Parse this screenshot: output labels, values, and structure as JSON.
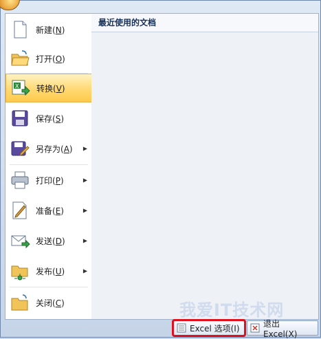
{
  "menu": {
    "items": [
      {
        "label": "新建",
        "key": "N",
        "has_submenu": false
      },
      {
        "label": "打开",
        "key": "O",
        "has_submenu": false
      },
      {
        "label": "转换",
        "key": "V",
        "has_submenu": false,
        "active": true
      },
      {
        "label": "保存",
        "key": "S",
        "has_submenu": false
      },
      {
        "label": "另存为",
        "key": "A",
        "has_submenu": true
      },
      {
        "label": "打印",
        "key": "P",
        "has_submenu": true
      },
      {
        "label": "准备",
        "key": "E",
        "has_submenu": true
      },
      {
        "label": "发送",
        "key": "D",
        "has_submenu": true
      },
      {
        "label": "发布",
        "key": "U",
        "has_submenu": true
      },
      {
        "label": "关闭",
        "key": "C",
        "has_submenu": false
      }
    ]
  },
  "recent": {
    "title": "最近使用的文档"
  },
  "footer": {
    "options_label": "Excel 选项(I)",
    "exit_label": "退出 Excel(X)"
  },
  "watermark": "我爱IT技术网",
  "colors": {
    "highlight": "#ffd872",
    "options_outline": "#e0101c"
  }
}
